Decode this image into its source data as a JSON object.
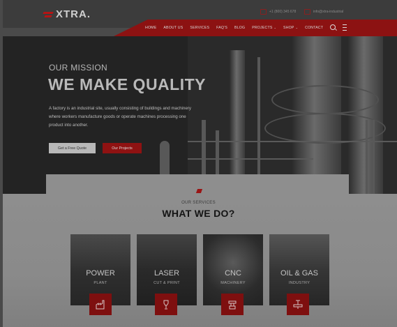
{
  "brand": {
    "name": "XTRA.",
    "accent": "#a11414"
  },
  "contact": {
    "phone": "+1 (800) 345 678",
    "email": "info@xtra-industrial"
  },
  "nav": {
    "items": [
      {
        "label": "HOME"
      },
      {
        "label": "ABOUT US"
      },
      {
        "label": "SERVICES"
      },
      {
        "label": "FAQ'S"
      },
      {
        "label": "BLOG"
      },
      {
        "label": "PROJECTS",
        "has_dropdown": true
      },
      {
        "label": "SHOP",
        "has_dropdown": true
      },
      {
        "label": "CONTACT"
      }
    ],
    "icons": [
      "search-icon",
      "menu-icon"
    ]
  },
  "hero": {
    "eyebrow": "OUR MISSION",
    "headline": "WE MAKE QUALITY",
    "description": "A factory is an industrial site, usually consisting of buildings and machinery where workers manufacture goods or operate machines processing one product into another.",
    "primary_button": "Get a Free Quote",
    "secondary_button": "Our Projects"
  },
  "services": {
    "label": "OUR SERVICES",
    "title": "WHAT WE DO?",
    "cards": [
      {
        "title": "POWER",
        "subtitle": "PLANT",
        "icon": "power-plant-icon"
      },
      {
        "title": "LASER",
        "subtitle": "CUT & PRINT",
        "icon": "laser-icon"
      },
      {
        "title": "CNC",
        "subtitle": "MACHINERY",
        "icon": "cnc-icon"
      },
      {
        "title": "OIL & GAS",
        "subtitle": "INDUSTRY",
        "icon": "oil-valve-icon"
      }
    ]
  }
}
